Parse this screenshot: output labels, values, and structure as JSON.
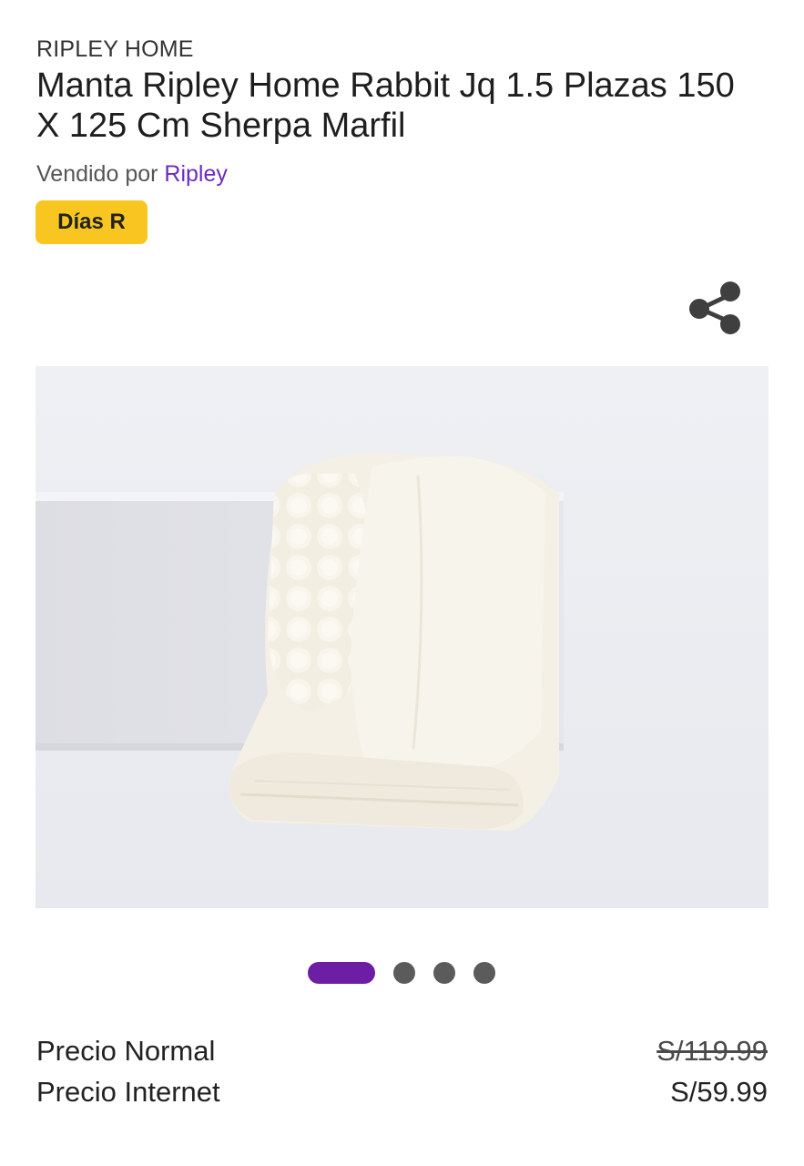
{
  "product": {
    "brand": "RIPLEY HOME",
    "title": "Manta Ripley Home Rabbit Jq 1.5 Plazas 150 X 125 Cm Sherpa Marfil",
    "seller_prefix": "Vendido por",
    "seller_name": "Ripley",
    "badge": "Días R"
  },
  "actions": {
    "share_icon": "share-icon"
  },
  "gallery": {
    "image_count": 4,
    "active_index": 0
  },
  "prices": {
    "normal_label": "Precio Normal",
    "normal_value": "S/119.99",
    "internet_label": "Precio Internet",
    "internet_value": "S/59.99"
  },
  "colors": {
    "accent": "#6c1ea5",
    "seller_link": "#6b2bbf",
    "badge": "#f9c621"
  }
}
